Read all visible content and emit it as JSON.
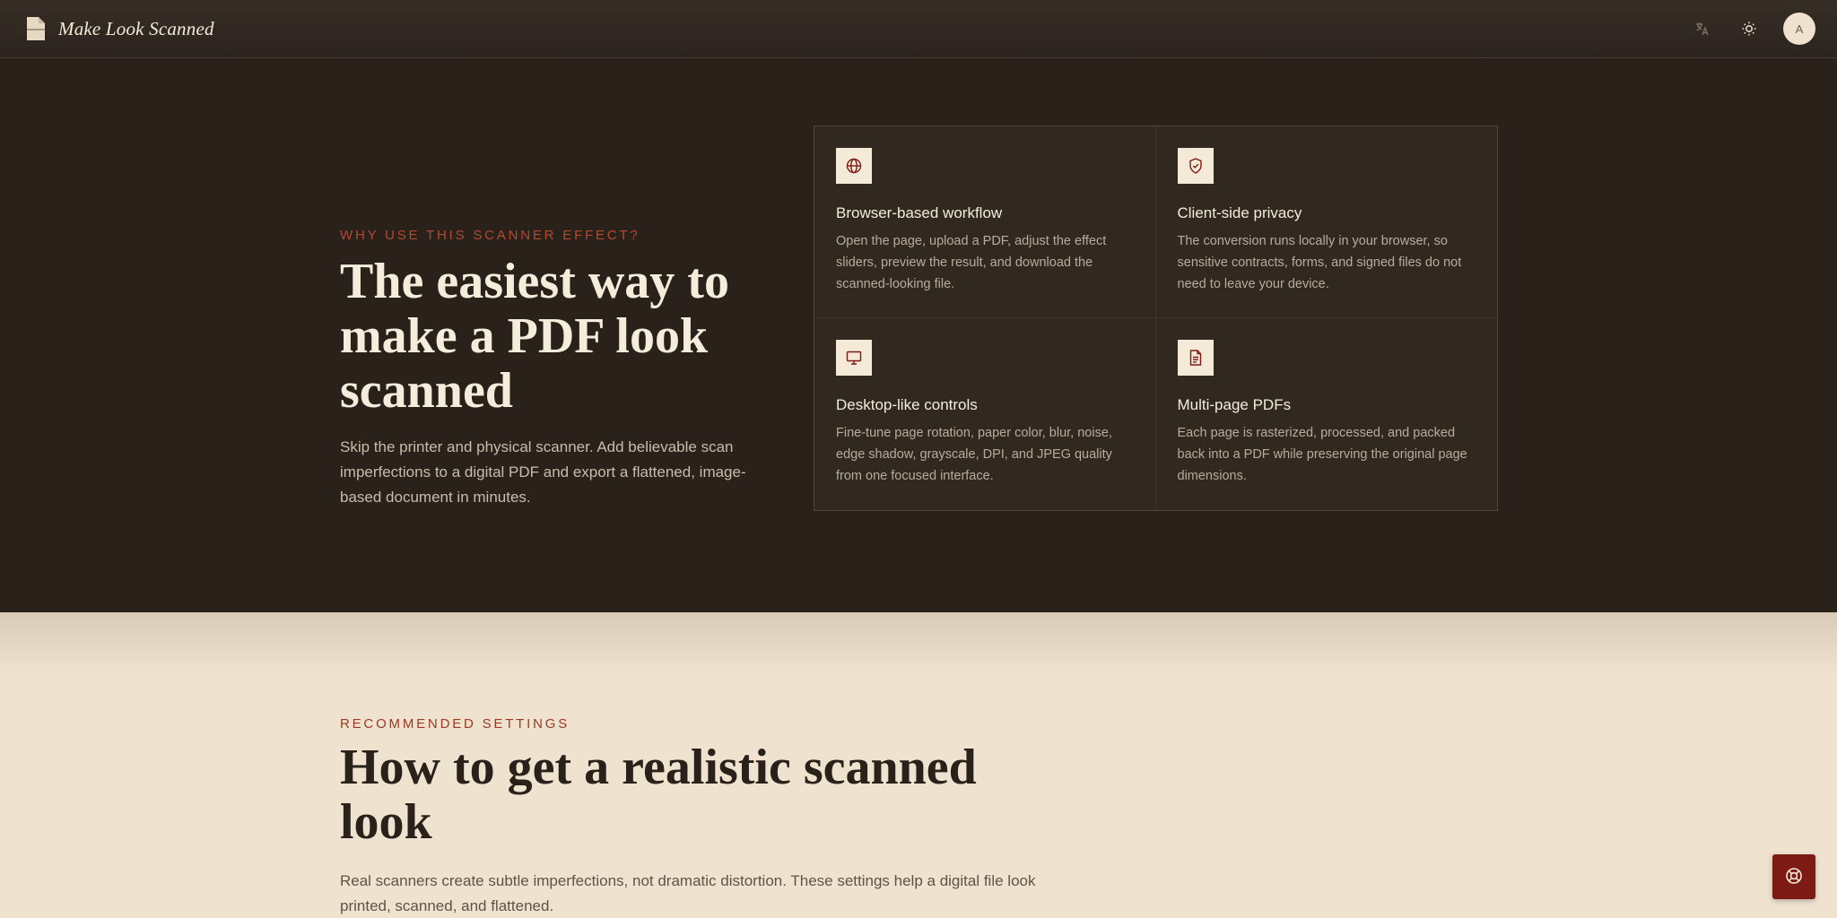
{
  "header": {
    "brand_title": "Make Look Scanned",
    "brand_icon": "document-icon",
    "actions": [
      {
        "name": "translate-icon"
      },
      {
        "name": "sun-icon"
      }
    ],
    "avatar_initial": "A"
  },
  "hero": {
    "eyebrow": "WHY USE THIS SCANNER EFFECT?",
    "title": "The easiest way to make a PDF look scanned",
    "body": "Skip the printer and physical scanner. Add believable scan imperfections to a digital PDF and export a flattened, image-based document in minutes.",
    "features": [
      {
        "icon": "globe-icon",
        "title": "Browser-based workflow",
        "body": "Open the page, upload a PDF, adjust the effect sliders, preview the result, and download the scanned-looking file."
      },
      {
        "icon": "shield-icon",
        "title": "Client-side privacy",
        "body": "The conversion runs locally in your browser, so sensitive contracts, forms, and signed files do not need to leave your device."
      },
      {
        "icon": "monitor-icon",
        "title": "Desktop-like controls",
        "body": "Fine-tune page rotation, paper color, blur, noise, edge shadow, grayscale, DPI, and JPEG quality from one focused interface."
      },
      {
        "icon": "file-text-icon",
        "title": "Multi-page PDFs",
        "body": "Each page is rasterized, processed, and packed back into a PDF while preserving the original page dimensions."
      }
    ]
  },
  "settings": {
    "eyebrow": "RECOMMENDED SETTINGS",
    "title": "How to get a realistic scanned look",
    "body": "Real scanners create subtle imperfections, not dramatic distortion. These settings help a digital file look printed, scanned, and flattened."
  },
  "help_button_icon": "lifebuoy-icon",
  "colors": {
    "accent": "#b34a30",
    "dark_bg": "#2a211b",
    "light_bg": "#efe3d0",
    "help_button": "#7e1a14"
  }
}
